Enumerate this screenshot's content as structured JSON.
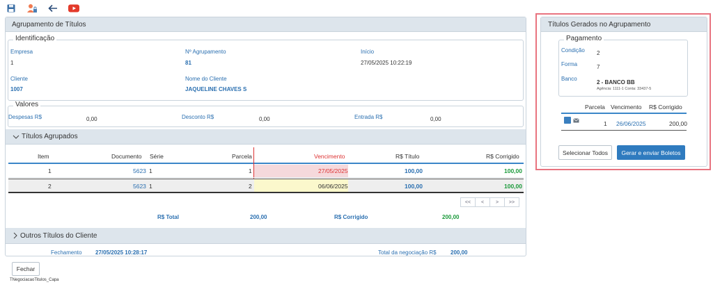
{
  "toolbar": {
    "icons": [
      "save-icon",
      "user-lock-icon",
      "back-arrow-icon",
      "youtube-icon"
    ]
  },
  "left": {
    "title": "Agrupamento de Títulos",
    "identificacao": {
      "legend": "Identificação",
      "empresa_label": "Empresa",
      "empresa_value": "1",
      "agrup_label": "Nº Agrupamento",
      "agrup_value": "81",
      "inicio_label": "Início",
      "inicio_value": "27/05/2025 10:22:19",
      "cliente_label": "Cliente",
      "cliente_value": "1007",
      "nome_label": "Nome do Cliente",
      "nome_value": "JAQUELINE CHAVES S"
    },
    "valores": {
      "legend": "Valores",
      "despesas_label": "Despesas R$",
      "despesas_value": "0,00",
      "desconto_label": "Desconto R$",
      "desconto_value": "0,00",
      "entrada_label": "Entrada R$",
      "entrada_value": "0,00"
    },
    "titulos": {
      "title": "Títulos Agrupados",
      "headers": {
        "item": "Item",
        "documento": "Documento",
        "serie": "Série",
        "parcela": "Parcela",
        "vencimento": "Vencimento",
        "titulo": "R$ Título",
        "corrigido": "R$ Corrigido"
      },
      "rows": [
        {
          "item": "1",
          "documento": "5623",
          "serie": "1",
          "parcela": "1",
          "vencimento": "27/05/2025",
          "titulo": "100,00",
          "corrigido": "100,00"
        },
        {
          "item": "2",
          "documento": "5623",
          "serie": "1",
          "parcela": "2",
          "vencimento": "06/06/2025",
          "titulo": "100,00",
          "corrigido": "100,00"
        }
      ],
      "pager": [
        "<<",
        "<",
        ">",
        ">>"
      ],
      "total_label": "R$ Total",
      "total_value": "200,00",
      "corrigido_label": "R$ Corrigido",
      "corrigido_value": "200,00"
    },
    "outros": {
      "title": "Outros Títulos do Cliente",
      "fechamento_label": "Fechamento",
      "fechamento_value": "27/05/2025 10:28:17",
      "total_neg_label": "Total da negociação R$",
      "total_neg_value": "200,00"
    },
    "fechar_label": "Fechar",
    "footer_text": "TNegociacaoTitulos_Capa"
  },
  "right": {
    "title": "Títulos Gerados no Agrupamento",
    "pagamento": {
      "legend": "Pagamento",
      "condicao_label": "Condição",
      "condicao_value": "2",
      "forma_label": "Forma",
      "forma_value": "7",
      "banco_label": "Banco",
      "banco_name": "2 - BANCO BB",
      "banco_detail": "Agência: 1111-1 Conta: 33437-5"
    },
    "table": {
      "headers": {
        "parcela": "Parcela",
        "vencimento": "Vencimento",
        "corrigido": "R$ Corrigido"
      },
      "rows": [
        {
          "parcela": "1",
          "vencimento": "26/06/2025",
          "corrigido": "200,00"
        }
      ]
    },
    "select_all_label": "Selecionar Todos",
    "generate_label": "Gerar e enviar Boletos"
  },
  "colors": {
    "accent": "#2f7bbf",
    "highlight_border": "#e8737f",
    "overdue_bg": "#f5d9dc",
    "due_bg": "#fbf8cc",
    "green": "#1a9a3a"
  }
}
